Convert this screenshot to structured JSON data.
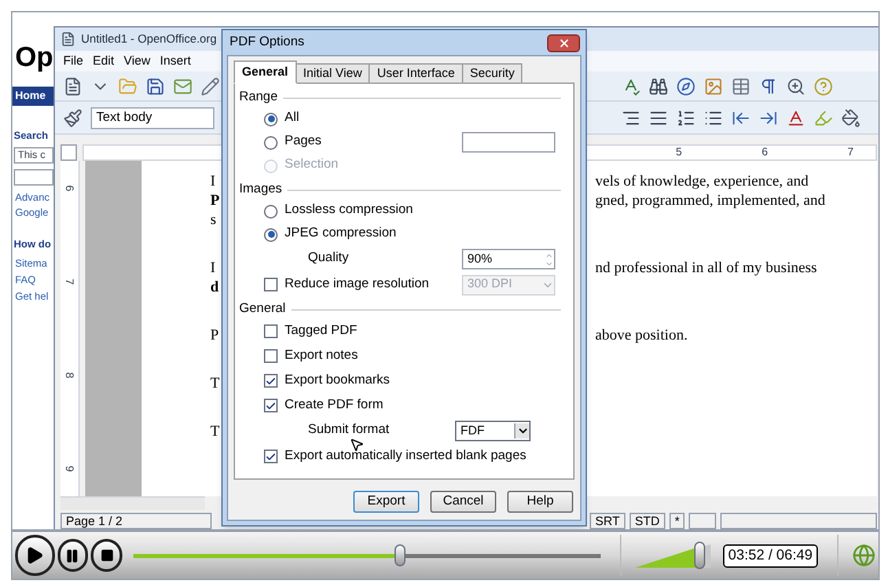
{
  "web_page": {
    "logo": "Op",
    "nav": "Home",
    "search_heading": "Search",
    "search_field": "This c",
    "search_links": [
      "Advanc",
      "Google"
    ],
    "help_heading": "How do",
    "help_links": [
      "Sitema",
      "FAQ",
      "Get hel"
    ]
  },
  "writer": {
    "title": "Untitled1 - OpenOffice.org",
    "menu": [
      "File",
      "Edit",
      "View",
      "Insert"
    ],
    "paragraph_style": "Text body",
    "ruler_marks": [
      "5",
      "6",
      "7"
    ],
    "vertical_ruler_marks": [
      "6",
      "7",
      "8",
      "9"
    ],
    "paragraphs": [
      {
        "lines": [
          {
            "left": "I",
            "left_bold": false,
            "right": "vels of knowledge, experience, and"
          },
          {
            "left": "P",
            "left_bold": true,
            "right": "gned, programmed, implemented, and"
          },
          {
            "left": "s",
            "left_bold": false
          }
        ]
      },
      {
        "lines": [
          {
            "left": "I",
            "left_bold": false,
            "right": "nd professional in all of my business"
          },
          {
            "left": "d",
            "left_bold": true
          }
        ]
      },
      {
        "lines": [
          {
            "left": "P",
            "left_bold": false,
            "right": "above position."
          }
        ]
      },
      {
        "lines": [
          {
            "left": "T",
            "left_bold": false
          }
        ]
      },
      {
        "lines": [
          {
            "left": "T",
            "left_bold": false
          }
        ]
      }
    ],
    "status_bar": [
      "Page 1 / 2",
      "SRT",
      "STD",
      "*"
    ]
  },
  "dialog": {
    "title": "PDF Options",
    "tabs": [
      {
        "label": "General",
        "selected": true
      },
      {
        "label": "Initial View",
        "selected": false
      },
      {
        "label": "User Interface",
        "selected": false
      },
      {
        "label": "Security",
        "selected": false
      }
    ],
    "sections": [
      {
        "heading": "Range",
        "items": [
          {
            "kind": "radio",
            "label": "All",
            "selected": true,
            "disabled": false
          },
          {
            "kind": "radio_field",
            "label": "Pages",
            "selected": false,
            "disabled": false
          },
          {
            "kind": "radio",
            "label": "Selection",
            "selected": false,
            "disabled": true
          }
        ]
      },
      {
        "heading": "Images",
        "items": [
          {
            "kind": "radio",
            "label": "Lossless compression",
            "selected": false,
            "disabled": false
          },
          {
            "kind": "radio",
            "label": "JPEG compression",
            "selected": true,
            "disabled": false
          },
          {
            "kind": "spin",
            "label": "Quality",
            "value": "90%"
          },
          {
            "kind": "checkbox_select",
            "label": "Reduce image resolution",
            "checked": false,
            "value": "300 DPI",
            "disabled": true
          }
        ]
      },
      {
        "heading": "General",
        "items": [
          {
            "kind": "checkbox",
            "label": "Tagged PDF",
            "checked": false
          },
          {
            "kind": "checkbox",
            "label": "Export notes",
            "checked": false
          },
          {
            "kind": "checkbox",
            "label": "Export bookmarks",
            "checked": true
          },
          {
            "kind": "checkbox",
            "label": "Create PDF form",
            "checked": true
          },
          {
            "kind": "select",
            "label": "Submit format",
            "value": "FDF",
            "disabled": false
          },
          {
            "kind": "checkbox",
            "label": "Export automatically inserted blank pages",
            "checked": true
          }
        ]
      }
    ],
    "buttons": [
      "Export",
      "Cancel",
      "Help"
    ]
  },
  "player": {
    "progress": {
      "level": 0.57
    },
    "volume": {
      "level": 0.95
    },
    "time": "03:52 / 06:49"
  }
}
